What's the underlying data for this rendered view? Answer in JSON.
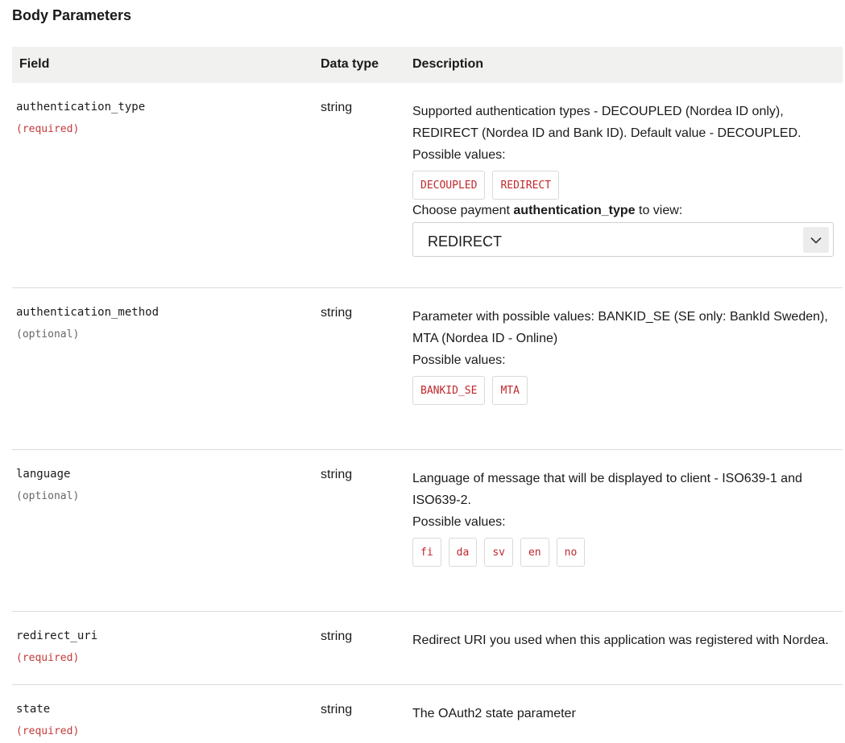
{
  "title": "Body Parameters",
  "columns": {
    "field": "Field",
    "data_type": "Data type",
    "description": "Description"
  },
  "rows": [
    {
      "field": "authentication_type",
      "requirement": "(required)",
      "data_type": "string",
      "description": "Supported authentication types - DECOUPLED (Nordea ID only), REDIRECT (Nordea ID and Bank ID). Default value - DECOUPLED.",
      "possible_values_label": "Possible values:",
      "possible_values": [
        "DECOUPLED",
        "REDIRECT"
      ],
      "choose_prefix": "Choose payment ",
      "choose_bold": "authentication_type",
      "choose_suffix": " to view:",
      "select_value": "REDIRECT"
    },
    {
      "field": "authentication_method",
      "requirement": "(optional)",
      "data_type": "string",
      "description": "Parameter with possible values: BANKID_SE (SE only: BankId Sweden), MTA (Nordea ID - Online)",
      "possible_values_label": "Possible values:",
      "possible_values": [
        "BANKID_SE",
        "MTA"
      ]
    },
    {
      "field": "language",
      "requirement": "(optional)",
      "data_type": "string",
      "description": "Language of message that will be displayed to client - ISO639-1 and ISO639-2.",
      "possible_values_label": "Possible values:",
      "possible_values": [
        "fi",
        "da",
        "sv",
        "en",
        "no"
      ]
    },
    {
      "field": "redirect_uri",
      "requirement": "(required)",
      "data_type": "string",
      "description": "Redirect URI you used when this application was registered with Nordea."
    },
    {
      "field": "state",
      "requirement": "(required)",
      "data_type": "string",
      "description": "The OAuth2 state parameter"
    }
  ],
  "colors": {
    "required": "#c33b3b",
    "chip_text": "#c0282d",
    "header_bg": "#f1f1f0"
  },
  "icons": {
    "select_toggle": "chevron-down-icon"
  }
}
